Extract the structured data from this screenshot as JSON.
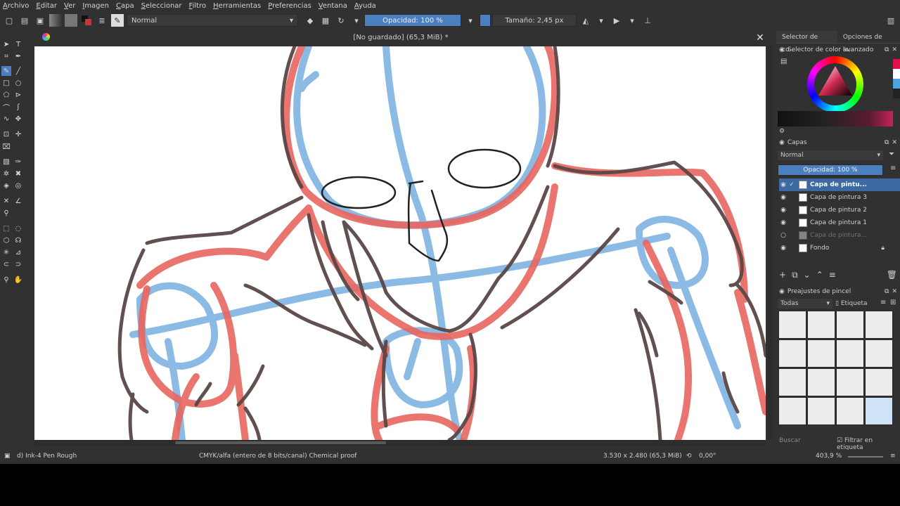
{
  "menu": [
    "Archivo",
    "Editar",
    "Ver",
    "Imagen",
    "Capa",
    "Seleccionar",
    "Filtro",
    "Herramientas",
    "Preferencias",
    "Ventana",
    "Ayuda"
  ],
  "toolbar": {
    "blend_mode": "Normal",
    "opacity_label": "Opacidad: 100 %",
    "size_label": "Tamaño: 2,45 px"
  },
  "document": {
    "title": "[No guardado] (65,3 MiB) *"
  },
  "dock": {
    "tabs": [
      "Selector de co...",
      "Opciones de la..."
    ],
    "color_selector_title": "Selector de color avanzado",
    "layers_title": "Capas",
    "layers_blend": "Normal",
    "layers_opacity": "Opacidad: 100 %",
    "layers": [
      {
        "name": "Capa de pintu...",
        "active": true
      },
      {
        "name": "Capa de pintura 3",
        "active": false
      },
      {
        "name": "Capa de pintura 2",
        "active": false
      },
      {
        "name": "Capa de pintura 1",
        "active": false
      },
      {
        "name": "Capa de pintura...",
        "active": false,
        "faded": true
      },
      {
        "name": "Fondo",
        "active": false
      }
    ],
    "presets_title": "Preajustes de pincel",
    "presets_filter": "Todas",
    "presets_tag": "Etiqueta",
    "search_placeholder": "Buscar",
    "filter_tag_label": "Filtrar en etiqueta"
  },
  "status": {
    "brush": "d) Ink-4 Pen Rough",
    "color_info": "CMYK/alfa (entero de 8 bits/canal)  Chemical proof",
    "dimensions": "3.530 x 2.480 (65,3 MiB)",
    "rotation": "0,00°",
    "zoom": "403,9 %"
  },
  "colors": {
    "accent": "#4c7fbf",
    "stroke_blue": "#7fb3e3",
    "stroke_red": "#e8655f",
    "stroke_dark": "#5a4747"
  }
}
